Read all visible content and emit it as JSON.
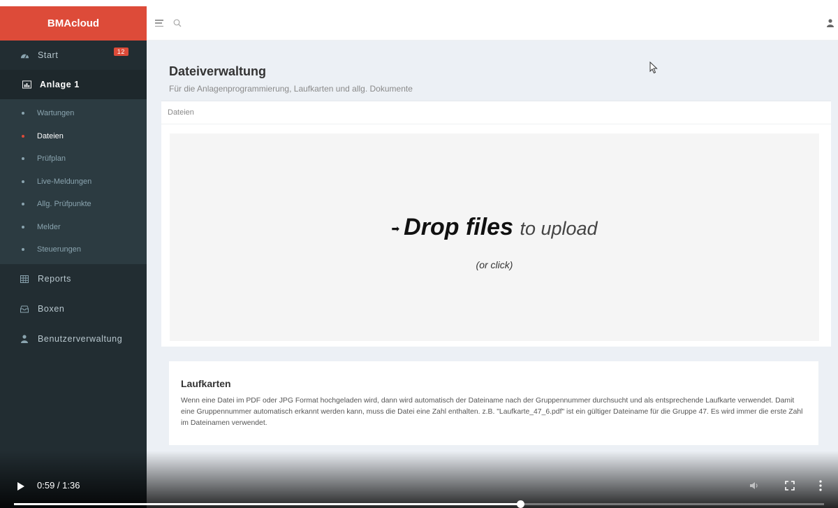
{
  "sidebar": {
    "brand": "BMAcloud",
    "items": [
      {
        "label": "Start",
        "icon": "dashboard-icon",
        "badge": "12"
      },
      {
        "label": "Anlage 1",
        "icon": "chart-icon"
      }
    ],
    "subitems": [
      {
        "label": "Wartungen"
      },
      {
        "label": "Dateien"
      },
      {
        "label": "Prüfplan"
      },
      {
        "label": "Live-Meldungen"
      },
      {
        "label": "Allg. Prüfpunkte"
      },
      {
        "label": "Melder"
      },
      {
        "label": "Steuerungen"
      }
    ],
    "lower": [
      {
        "label": "Reports",
        "icon": "table-icon"
      },
      {
        "label": "Boxen",
        "icon": "box-icon"
      },
      {
        "label": "Benutzerverwaltung",
        "icon": "user-icon"
      }
    ]
  },
  "page": {
    "title": "Dateiverwaltung",
    "subtitle": "Für die Anlagenprogrammierung, Laufkarten und allg. Dokumente"
  },
  "files_box": {
    "header": "Dateien",
    "drop_strong": "Drop files",
    "drop_light": "to upload",
    "drop_sub": "(or click)"
  },
  "laufkarten": {
    "title": "Laufkarten",
    "text": "Wenn eine Datei im PDF oder JPG Format hochgeladen wird, dann wird automatisch der Dateiname nach der Gruppennummer durchsucht und als entsprechende Laufkarte verwendet. Damit eine Gruppennummer automatisch erkannt werden kann, muss die Datei eine Zahl enthalten. z.B. \"Laufkarte_47_6.pdf\" ist ein gültiger Dateiname für die Gruppe 47. Es wird immer die erste Zahl im Dateinamen verwendet."
  },
  "video": {
    "time": "0:59 / 1:36",
    "progress": 0.625
  },
  "colors": {
    "brand": "#dd4b39",
    "sidebar_bg": "#222d32",
    "content_bg": "#ecf0f5"
  }
}
